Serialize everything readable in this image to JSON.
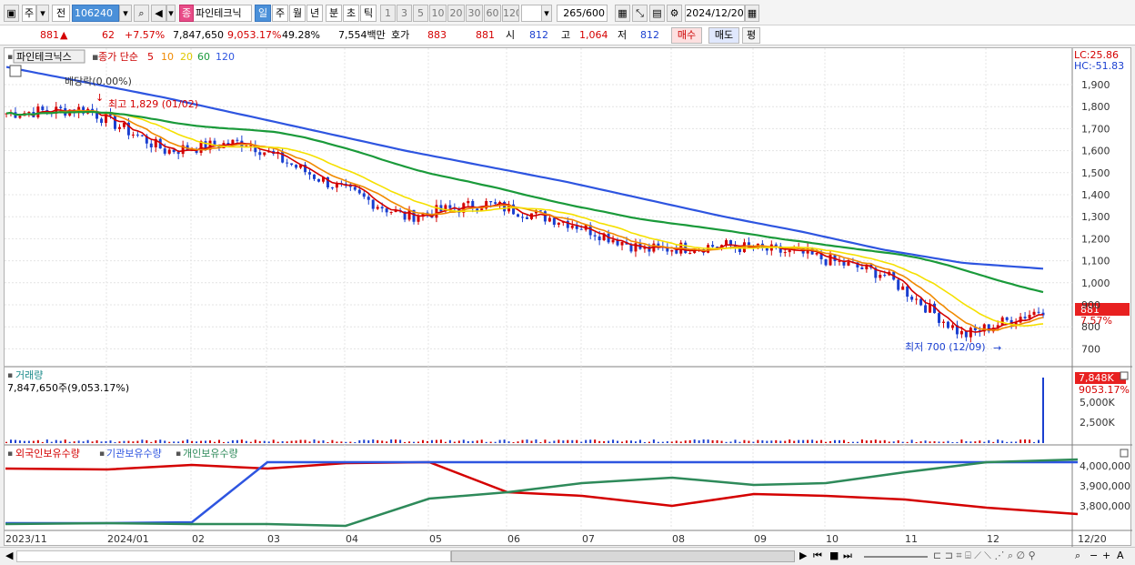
{
  "toolbar": {
    "market": "주",
    "type": "전",
    "code": "106240",
    "name": "파인테크닉",
    "name_badge": "종",
    "periods": [
      "일",
      "주",
      "월",
      "년",
      "분",
      "초",
      "틱"
    ],
    "period_selected": "일",
    "intervals": [
      "1",
      "3",
      "5",
      "10",
      "20",
      "30",
      "60",
      "120"
    ],
    "count": "265",
    "count_total": "/600",
    "date": "2024/12/20"
  },
  "quote": {
    "price": "881",
    "change": "62",
    "change_pct": "+7.57%",
    "volume": "7,847,650",
    "volume_ratio": "9,053.17%",
    "turnover": "49.28%",
    "amount": "7,554백만",
    "hoga_label": "호가",
    "ask": "883",
    "bid": "881",
    "open_label": "시",
    "open": "812",
    "high_label": "고",
    "high": "1,064",
    "low_label": "저",
    "low": "812",
    "buy_label": "매수",
    "sell_label": "매도",
    "avg_label": "평"
  },
  "price_panel": {
    "title": "파인테크닉스",
    "ma_label": "종가 단순",
    "ma_periods": [
      "5",
      "10",
      "20",
      "60",
      "120"
    ],
    "ma_colors": [
      "#d40000",
      "#f08a00",
      "#f5e000",
      "#1a9a3a",
      "#2e55e0"
    ],
    "dividend": "배당락(0.00%)",
    "high_marker": "최고 1,829 (01/02)",
    "low_marker": "최저 700 (12/09)",
    "lc": "LC:25.86",
    "hc": "HC:-51.83",
    "current_tag": "881",
    "current_pct": "7.57%",
    "y_ticks": [
      "1,900",
      "1,800",
      "1,700",
      "1,600",
      "1,500",
      "1,400",
      "1,300",
      "1,200",
      "1,100",
      "1,000",
      "900",
      "800",
      "700"
    ]
  },
  "volume_panel": {
    "title": "거래량",
    "info": "7,847,650주(9,053.17%)",
    "tag": "7,848K",
    "tag_pct": "9053.17%",
    "y_ticks": [
      "5,000K",
      "2,500K"
    ]
  },
  "holding_panel": {
    "labels": [
      "외국인보유수량",
      "기관보유수량",
      "개인보유수량"
    ],
    "colors": [
      "#d40000",
      "#2e55e0",
      "#2e8a5a"
    ],
    "y_ticks": [
      "4,000,000",
      "3,900,000",
      "3,800,000"
    ]
  },
  "x_axis": [
    "2023/11",
    "2024/01",
    "02",
    "03",
    "04",
    "05",
    "06",
    "07",
    "08",
    "09",
    "10",
    "11",
    "12",
    "12/20"
  ],
  "chart_data": {
    "type": "line",
    "title": "파인테크닉스",
    "x": [
      "2023/11",
      "2024/01",
      "02",
      "03",
      "04",
      "05",
      "06",
      "07",
      "08",
      "09",
      "10",
      "11",
      "12",
      "12/20"
    ],
    "series": [
      {
        "name": "종가",
        "values": [
          1770,
          1790,
          1600,
          1640,
          1460,
          1300,
          1360,
          1280,
          1150,
          1170,
          1130,
          1040,
          760,
          881
        ]
      },
      {
        "name": "120",
        "values": [
          1980,
          1910,
          1840,
          1760,
          1680,
          1600,
          1530,
          1460,
          1380,
          1300,
          1230,
          1150,
          1090,
          1064
        ]
      }
    ],
    "ylim": [
      650,
      1950
    ]
  }
}
